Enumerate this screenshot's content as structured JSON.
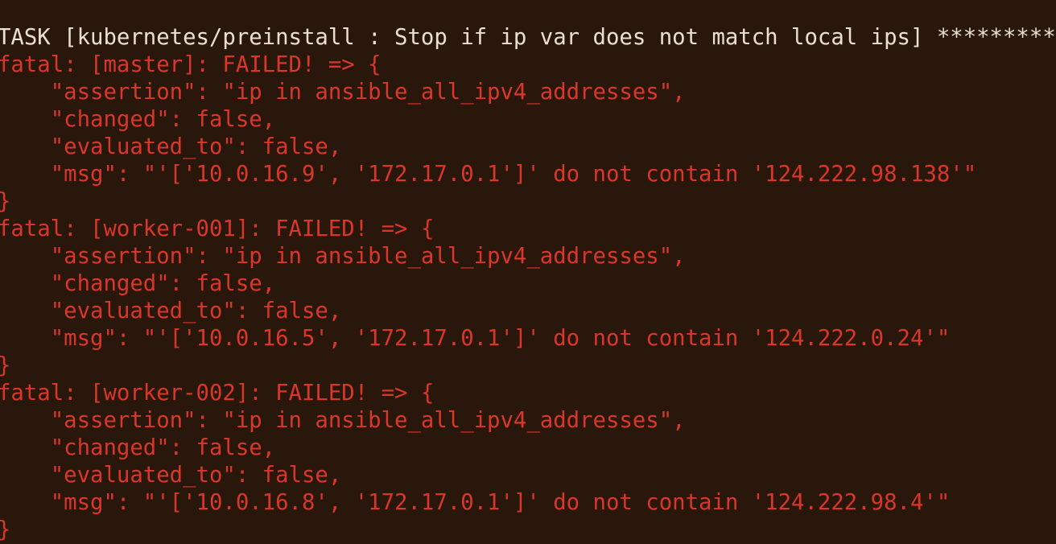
{
  "colors": {
    "background": "#2a170b",
    "task_text": "#e9e0cf",
    "error_text": "#d8372a"
  },
  "task_line": "TASK [kubernetes/preinstall : Stop if ip var does not match local ips] *********",
  "hosts": [
    {
      "header": "fatal: [master]: FAILED! => {",
      "assertion": "    \"assertion\": \"ip in ansible_all_ipv4_addresses\",",
      "changed": "    \"changed\": false,",
      "evaluated_to": "    \"evaluated_to\": false,",
      "msg": "    \"msg\": \"'['10.0.16.9', '172.17.0.1']' do not contain '124.222.98.138'\"",
      "close": "}"
    },
    {
      "header": "fatal: [worker-001]: FAILED! => {",
      "assertion": "    \"assertion\": \"ip in ansible_all_ipv4_addresses\",",
      "changed": "    \"changed\": false,",
      "evaluated_to": "    \"evaluated_to\": false,",
      "msg": "    \"msg\": \"'['10.0.16.5', '172.17.0.1']' do not contain '124.222.0.24'\"",
      "close": "}"
    },
    {
      "header": "fatal: [worker-002]: FAILED! => {",
      "assertion": "    \"assertion\": \"ip in ansible_all_ipv4_addresses\",",
      "changed": "    \"changed\": false,",
      "evaluated_to": "    \"evaluated_to\": false,",
      "msg": "    \"msg\": \"'['10.0.16.8', '172.17.0.1']' do not contain '124.222.98.4'\"",
      "close": "}"
    }
  ]
}
